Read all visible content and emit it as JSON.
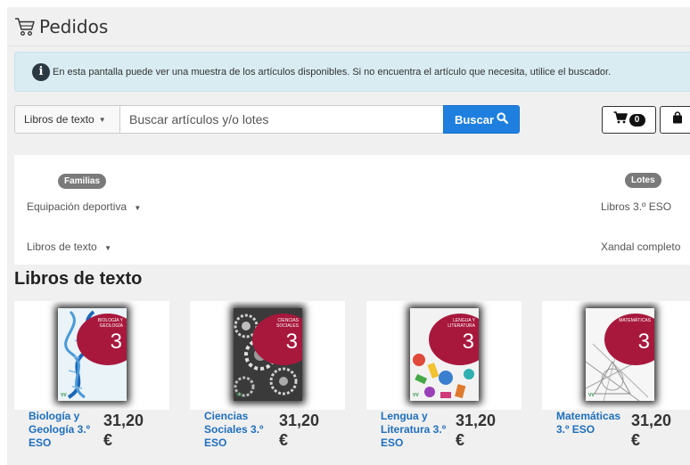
{
  "header": {
    "title": "Pedidos",
    "icon": "shopping-cart-icon"
  },
  "info": {
    "icon": "info-circle-icon",
    "text": "En esta pantalla puede ver una muestra de los artículos disponibles. Si no encuentra el artículo que necesita, utilice el buscador."
  },
  "search": {
    "category": "Libros de texto",
    "placeholder": "Buscar artículos y/o lotes",
    "value": "",
    "button_label": "Buscar",
    "button_icon": "search-icon"
  },
  "cart": {
    "icon": "shopping-cart-icon",
    "count": "0"
  },
  "bag": {
    "icon": "shopping-bag-icon"
  },
  "filters": {
    "families_label": "Familias",
    "lots_label": "Lotes",
    "families": [
      {
        "label": "Equipación deportiva"
      },
      {
        "label": "Libros de texto"
      }
    ],
    "lots": [
      {
        "label": "Libros 3.º ESO"
      },
      {
        "label": "Xandal completo"
      }
    ]
  },
  "section_title": "Libros de texto",
  "products": [
    {
      "name": "Biología y Geología 3.º ESO",
      "price": "31,20",
      "currency": "€",
      "cover_title": "BIOLOGÍA Y GEOLOGÍA",
      "cover_number": "3",
      "cover_logo": "VV"
    },
    {
      "name": "Ciencias Sociales 3.º ESO",
      "price": "31,20",
      "currency": "€",
      "cover_title": "CIENCIAS SOCIALES",
      "cover_number": "3",
      "cover_logo": "VV"
    },
    {
      "name": "Lengua y Literatura 3.º ESO",
      "price": "31,20",
      "currency": "€",
      "cover_title": "LENGUA Y LITERATURA",
      "cover_number": "3",
      "cover_logo": "VV"
    },
    {
      "name": "Matemáticas 3.º ESO",
      "price": "31,20",
      "currency": "€",
      "cover_title": "MATEMÁTICAS",
      "cover_number": "3",
      "cover_logo": "VV"
    }
  ],
  "colors": {
    "accent": "#1e7fde",
    "info_background": "#d9ecf2",
    "cover_accent": "#a8183d",
    "link": "#1f6fbd"
  }
}
